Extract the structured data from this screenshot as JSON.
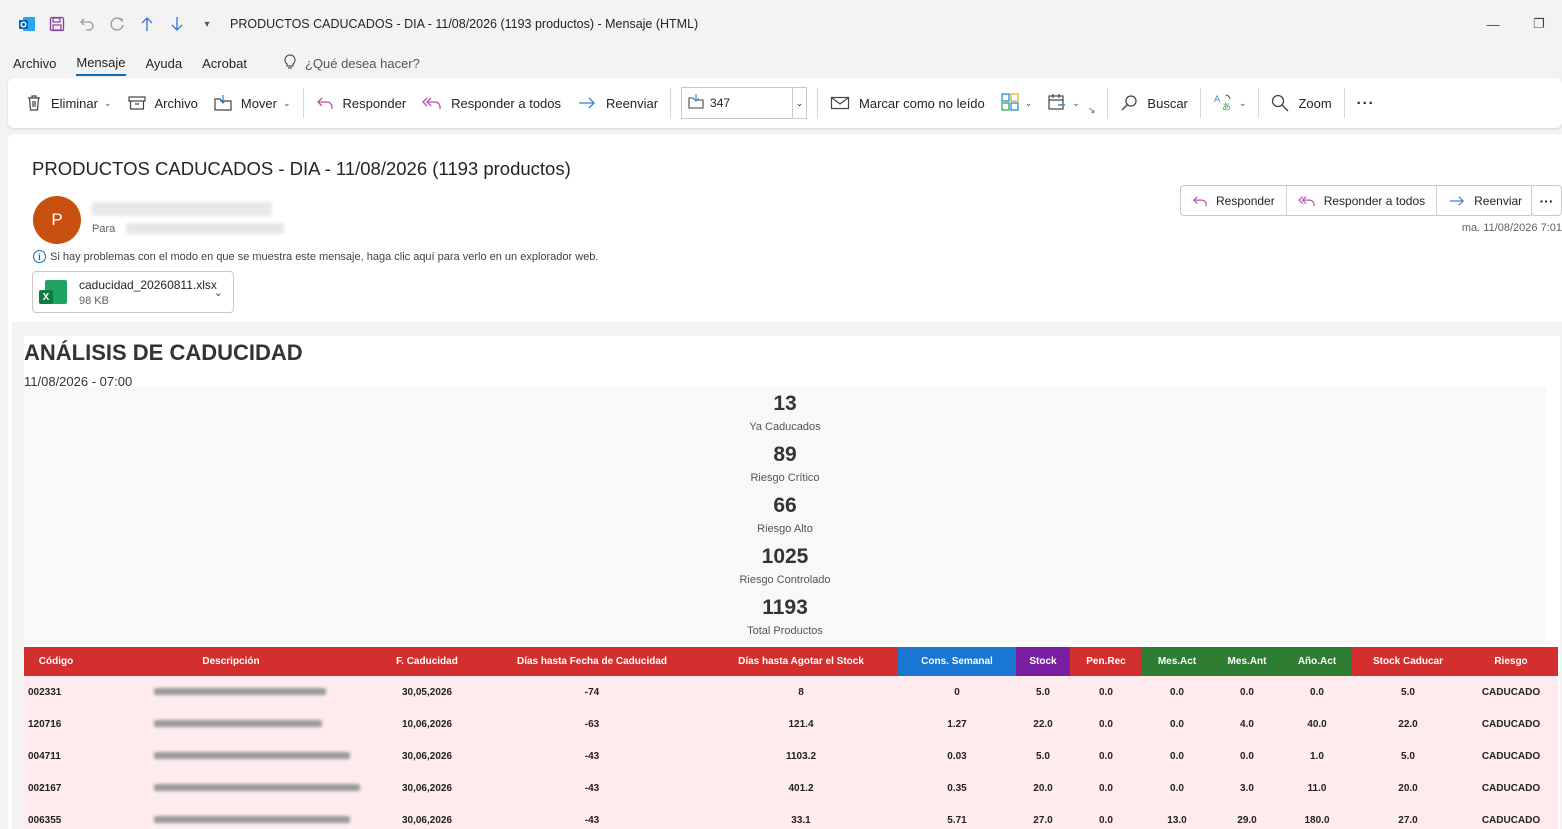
{
  "window": {
    "title": "PRODUCTOS CADUCADOS - DIA - 11/08/2026 (1193 productos)  -  Mensaje (HTML)"
  },
  "menu": {
    "items": [
      "Archivo",
      "Mensaje",
      "Ayuda",
      "Acrobat"
    ],
    "active": "Mensaje",
    "search_placeholder": "¿Qué desea hacer?"
  },
  "ribbon": {
    "delete": "Eliminar",
    "archive": "Archivo",
    "move": "Mover",
    "reply": "Responder",
    "reply_all": "Responder a todos",
    "forward": "Reenviar",
    "folder_value": "347",
    "mark_unread": "Marcar como no leído",
    "search": "Buscar",
    "zoom": "Zoom"
  },
  "message": {
    "subject": "PRODUCTOS CADUCADOS - DIA - 11/08/2026 (1193 productos)",
    "avatar_initial": "P",
    "to_label": "Para",
    "actions": {
      "reply": "Responder",
      "reply_all": "Responder a todos",
      "forward": "Reenviar"
    },
    "datetime": "ma. 11/08/2026 7:01",
    "info_text": "Si hay problemas con el modo en que se muestra este mensaje, haga clic aquí para verlo en un explorador web.",
    "attachment": {
      "name": "caducidad_20260811.xlsx",
      "size": "98 KB"
    }
  },
  "report": {
    "title": "ANÁLISIS DE CADUCIDAD",
    "subtitle": "11/08/2026 - 07:00",
    "stats": [
      {
        "value": "13",
        "label": "Ya Caducados"
      },
      {
        "value": "89",
        "label": "Riesgo Crítico"
      },
      {
        "value": "66",
        "label": "Riesgo Alto"
      },
      {
        "value": "1025",
        "label": "Riesgo Controlado"
      },
      {
        "value": "1193",
        "label": "Total Productos"
      }
    ],
    "columns": [
      "Código",
      "Descripción",
      "F. Caducidad",
      "Días hasta Fecha de Caducidad",
      "Días hasta Agotar el Stock",
      "Cons. Semanal",
      "Stock",
      "Pen.Rec",
      "Mes.Act",
      "Mes.Ant",
      "Año.Act",
      "Stock Caducar",
      "Riesgo"
    ],
    "rows": [
      [
        "002331",
        "",
        "30,05,2026",
        "-74",
        "8",
        "0",
        "5.0",
        "0.0",
        "0.0",
        "0.0",
        "0.0",
        "5.0",
        "CADUCADO"
      ],
      [
        "120716",
        "",
        "10,06,2026",
        "-63",
        "121.4",
        "1.27",
        "22.0",
        "0.0",
        "0.0",
        "4.0",
        "40.0",
        "22.0",
        "CADUCADO"
      ],
      [
        "004711",
        "",
        "30,06,2026",
        "-43",
        "1103.2",
        "0.03",
        "5.0",
        "0.0",
        "0.0",
        "0.0",
        "1.0",
        "5.0",
        "CADUCADO"
      ],
      [
        "002167",
        "",
        "30,06,2026",
        "-43",
        "401.2",
        "0.35",
        "20.0",
        "0.0",
        "0.0",
        "3.0",
        "11.0",
        "20.0",
        "CADUCADO"
      ],
      [
        "006355",
        "",
        "30,06,2026",
        "-43",
        "33.1",
        "5.71",
        "27.0",
        "0.0",
        "13.0",
        "29.0",
        "180.0",
        "27.0",
        "CADUCADO"
      ]
    ]
  }
}
